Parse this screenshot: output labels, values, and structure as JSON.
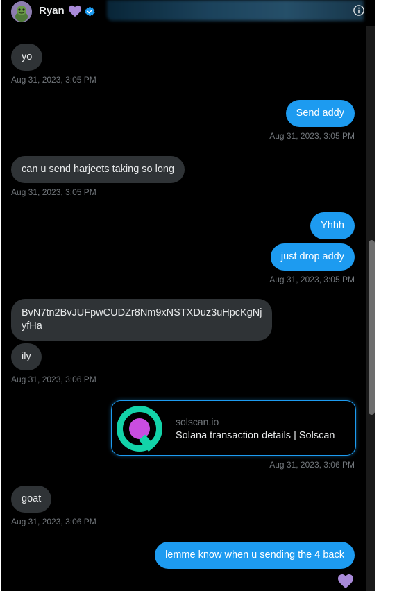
{
  "header": {
    "contact_name": "Ryan",
    "name_emoji_icon": "purple-heart-icon",
    "verified_icon": "verified-badge-icon",
    "info_icon": "info-icon"
  },
  "colors": {
    "background": "#000000",
    "incoming_bubble": "#2f3336",
    "outgoing_bubble": "#1d9bf0",
    "timestamp": "#71767b",
    "heart": "#a98ad9"
  },
  "messages": [
    {
      "direction": "incoming",
      "text": "yo"
    },
    {
      "timestamp": "Aug 31, 2023, 3:05 PM"
    },
    {
      "direction": "outgoing",
      "text": "Send addy"
    },
    {
      "timestamp": "Aug 31, 2023, 3:05 PM"
    },
    {
      "direction": "incoming",
      "text": "can u send harjeets taking so long"
    },
    {
      "timestamp": "Aug 31, 2023, 3:05 PM"
    },
    {
      "direction": "outgoing",
      "text": "Yhhh"
    },
    {
      "direction": "outgoing",
      "text": "just drop addy"
    },
    {
      "timestamp": "Aug 31, 2023, 3:05 PM"
    },
    {
      "direction": "incoming",
      "text_line1": "BvN7tn2BvJUFpwCUDZr8Nm9xNSTXDuz3uHpcKgNj",
      "text_line2": "yfHa"
    },
    {
      "direction": "incoming",
      "text": "ily"
    },
    {
      "timestamp": "Aug 31, 2023, 3:06 PM"
    },
    {
      "direction": "outgoing",
      "link_card": {
        "domain": "solscan.io",
        "title": "Solana transaction details | Solscan"
      }
    },
    {
      "timestamp": "Aug 31, 2023, 3:06 PM"
    },
    {
      "direction": "incoming",
      "text": "goat"
    },
    {
      "timestamp": "Aug 31, 2023, 3:06 PM"
    },
    {
      "direction": "outgoing",
      "text": "lemme know when u sending the 4 back",
      "reaction": "purple-heart-icon"
    }
  ]
}
